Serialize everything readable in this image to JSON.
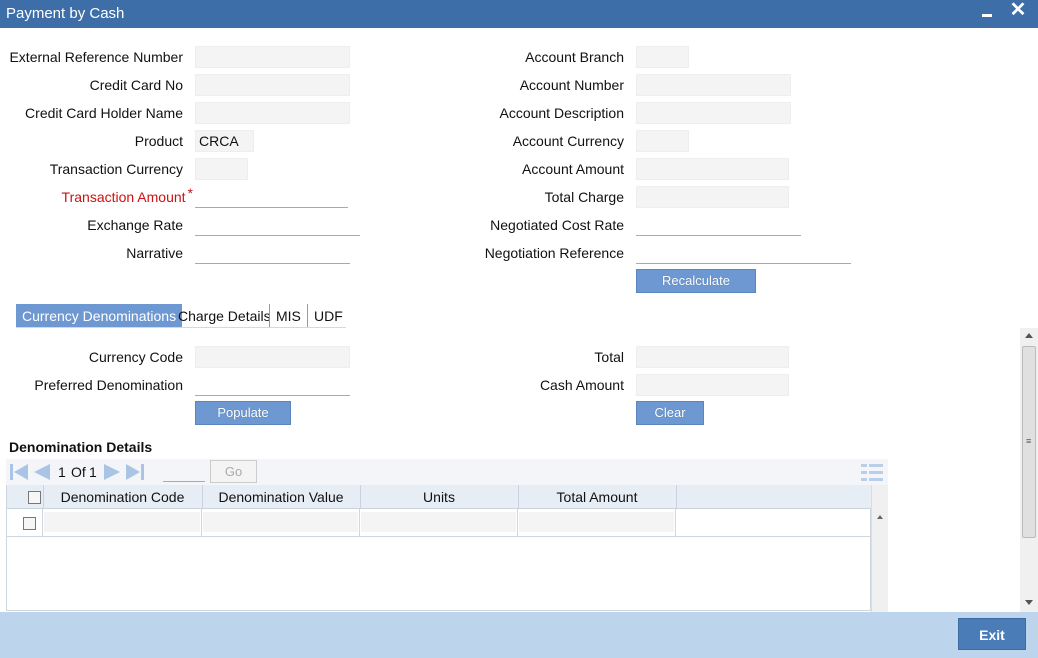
{
  "window": {
    "title": "Payment by Cash"
  },
  "form": {
    "left": [
      {
        "label": "External Reference Number",
        "value": ""
      },
      {
        "label": "Credit Card No",
        "value": ""
      },
      {
        "label": "Credit Card Holder Name",
        "value": ""
      },
      {
        "label": "Product",
        "value": "CRCA"
      },
      {
        "label": "Transaction Currency",
        "value": ""
      },
      {
        "label": "Transaction Amount",
        "value": "",
        "required": true
      },
      {
        "label": "Exchange Rate",
        "value": ""
      },
      {
        "label": "Narrative",
        "value": ""
      }
    ],
    "right": [
      {
        "label": "Account Branch",
        "value": ""
      },
      {
        "label": "Account Number",
        "value": ""
      },
      {
        "label": "Account Description",
        "value": ""
      },
      {
        "label": "Account Currency",
        "value": ""
      },
      {
        "label": "Account Amount",
        "value": ""
      },
      {
        "label": "Total Charge",
        "value": ""
      },
      {
        "label": "Negotiated Cost Rate",
        "value": ""
      },
      {
        "label": "Negotiation Reference",
        "value": ""
      }
    ],
    "recalculate_label": "Recalculate"
  },
  "tabs": [
    "Currency Denominations",
    "Charge Details",
    "MIS",
    "UDF"
  ],
  "denom": {
    "currency_code_label": "Currency Code",
    "currency_code_value": "",
    "preferred_denomination_label": "Preferred Denomination",
    "preferred_denomination_value": "",
    "total_label": "Total",
    "total_value": "",
    "cash_amount_label": "Cash Amount",
    "cash_amount_value": "",
    "populate_label": "Populate",
    "clear_label": "Clear"
  },
  "details": {
    "title": "Denomination Details",
    "pager": {
      "current": "1",
      "of_label": "Of",
      "total": "1",
      "goto_value": "",
      "go_label": "Go"
    },
    "columns": [
      "Denomination Code",
      "Denomination Value",
      "Units",
      "Total Amount"
    ]
  },
  "footer": {
    "exit_label": "Exit"
  },
  "colors": {
    "titlebar": "#3e6ea8",
    "button": "#6d98d1",
    "required": "#cc1111",
    "footer": "#bcd4ec",
    "exit": "#4a7db8"
  }
}
